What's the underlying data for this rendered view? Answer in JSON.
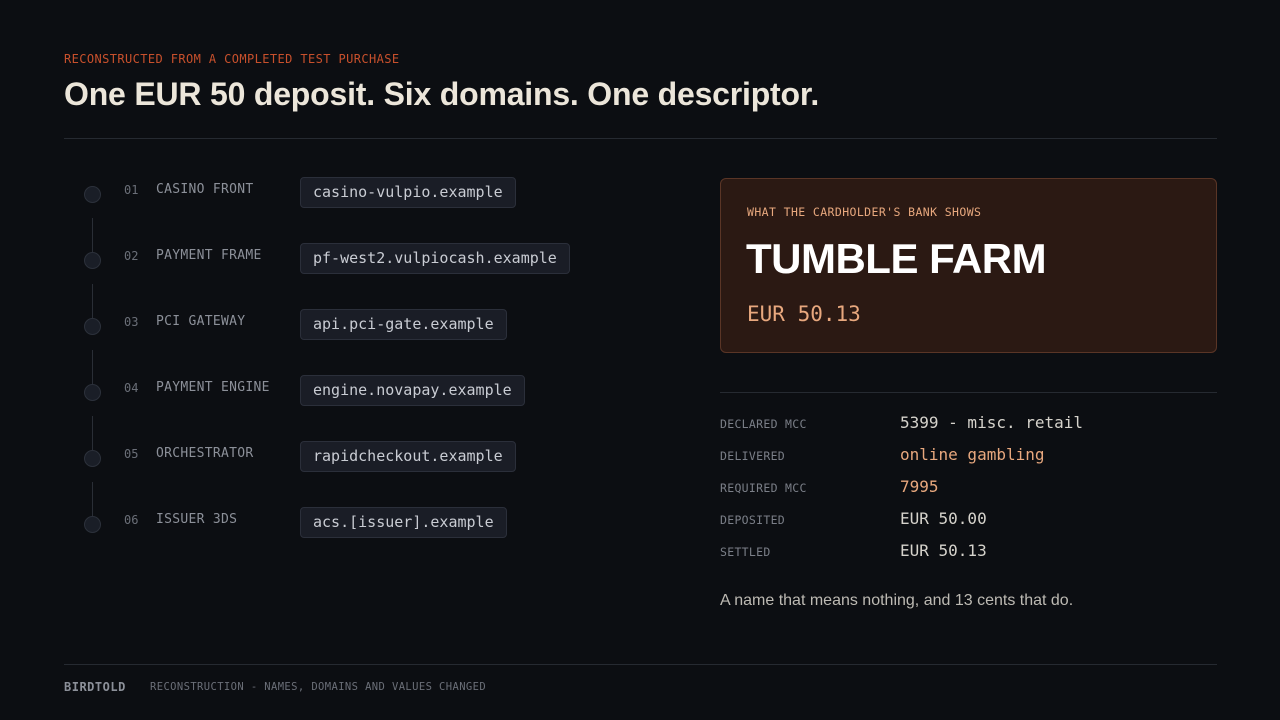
{
  "header": {
    "eyebrow": "RECONSTRUCTED FROM A COMPLETED TEST PURCHASE",
    "title": "One EUR 50 deposit. Six domains. One descriptor."
  },
  "chain": {
    "steps": [
      {
        "num": "01",
        "label": "CASINO FRONT",
        "domain": "casino-vulpio.example"
      },
      {
        "num": "02",
        "label": "PAYMENT FRAME",
        "domain": "pf-west2.vulpiocash.example"
      },
      {
        "num": "03",
        "label": "PCI GATEWAY",
        "domain": "api.pci-gate.example"
      },
      {
        "num": "04",
        "label": "PAYMENT ENGINE",
        "domain": "engine.novapay.example"
      },
      {
        "num": "05",
        "label": "ORCHESTRATOR",
        "domain": "rapidcheckout.example"
      },
      {
        "num": "06",
        "label": "ISSUER 3DS",
        "domain": "acs.[issuer].example"
      }
    ]
  },
  "card": {
    "eyebrow": "WHAT THE CARDHOLDER'S BANK SHOWS",
    "descriptor": "TUMBLE FARM",
    "amount": "EUR 50.13"
  },
  "facts": [
    {
      "key": "DECLARED MCC",
      "value": "5399 - misc. retail",
      "accent": false
    },
    {
      "key": "DELIVERED",
      "value": "online gambling",
      "accent": true
    },
    {
      "key": "REQUIRED MCC",
      "value": "7995",
      "accent": true
    },
    {
      "key": "DEPOSITED",
      "value": "EUR 50.00",
      "accent": false
    },
    {
      "key": "SETTLED",
      "value": "EUR 50.13",
      "accent": false
    }
  ],
  "caption": "A name that means nothing, and 13 cents that do.",
  "footer": {
    "brand": "BIRDTOLD",
    "note": "RECONSTRUCTION - NAMES, DOMAINS AND VALUES CHANGED"
  },
  "colors": {
    "background": "#0c0e12",
    "accent_red": "#c8502c",
    "accent_peach": "#e8a87e",
    "card_bg": "#2b1913"
  }
}
